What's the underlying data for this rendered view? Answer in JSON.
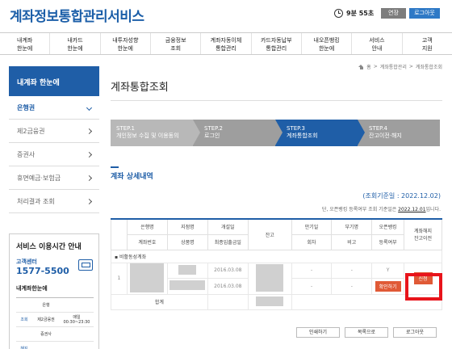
{
  "header": {
    "logo": "계좌정보통합관리서비스",
    "timer": "9분 55초",
    "extend_label": "연장",
    "logout_label": "로그아웃"
  },
  "nav": [
    {
      "l1": "내계좌",
      "l2": "한눈에"
    },
    {
      "l1": "내카드",
      "l2": "한눈에"
    },
    {
      "l1": "내투자성향",
      "l2": "한눈에"
    },
    {
      "l1": "금융정보",
      "l2": "조회"
    },
    {
      "l1": "계좌자동이체",
      "l2": "통합관리"
    },
    {
      "l1": "카드자동납부",
      "l2": "통합관리"
    },
    {
      "l1": "내오픈뱅킹",
      "l2": "한눈에"
    },
    {
      "l1": "서비스",
      "l2": "안내"
    },
    {
      "l1": "고객",
      "l2": "지원"
    }
  ],
  "breadcrumb": [
    "홈",
    "계좌통합관리",
    "계좌통합조회"
  ],
  "sidebar": {
    "heading": "내계좌 한눈에",
    "items": [
      {
        "label": "은행권",
        "active": true
      },
      {
        "label": "제2금융권",
        "active": false
      },
      {
        "label": "증권사",
        "active": false
      },
      {
        "label": "휴면예금·보험금",
        "active": false
      },
      {
        "label": "처리결과 조회",
        "active": false
      }
    ],
    "service": {
      "title": "서비스 이용시간 안내",
      "center": "고객센터",
      "phone": "1577-5500",
      "subtitle": "내계좌한눈에",
      "row_group": "조회",
      "rows": [
        {
          "org": "은행",
          "time": "매일"
        },
        {
          "org": "제2금융권",
          "time": "00:30~23:30"
        },
        {
          "org": "증권사",
          "time": ""
        }
      ],
      "extra_cell": "해지"
    }
  },
  "main": {
    "title": "계좌통합조회",
    "steps": [
      {
        "num": "STEP.1",
        "label": "개인정보 수집 및 이용동의"
      },
      {
        "num": "STEP.2",
        "label": "로그인"
      },
      {
        "num": "STEP.3",
        "label": "계좌통합조회"
      },
      {
        "num": "STEP.4",
        "label": "잔고이전·해지"
      }
    ],
    "section_title": "계좌 상세내역",
    "std_date": "(조회기준일 : 2022.12.02)",
    "note_prefix": "단, 오픈뱅킹 등록여부 조회 기준일은 ",
    "note_date": "2022.12.01",
    "note_suffix": "입니다.",
    "table": {
      "headers_r1": [
        "은행명",
        "지점명",
        "개설일",
        "잔고",
        "만기일",
        "부기명",
        "오픈뱅킹",
        "계좌해지"
      ],
      "headers_r2": [
        "계좌번호",
        "상품명",
        "최종입출금일",
        "회차",
        "비고",
        "등록여부",
        "잔고이전"
      ],
      "group_label": "비활동성계좌",
      "row_num": "1",
      "open_date": "2016.03.08",
      "last_date": "2016.03.08",
      "maturity": "-",
      "round": "-",
      "memo": "-",
      "note": "-",
      "openbanking": "Y",
      "confirm_label": "확인하기",
      "apply_label": "신청",
      "total_label": "합계"
    },
    "buttons": {
      "print": "인쇄하기",
      "list": "목록으로",
      "logout": "로그아웃"
    }
  }
}
